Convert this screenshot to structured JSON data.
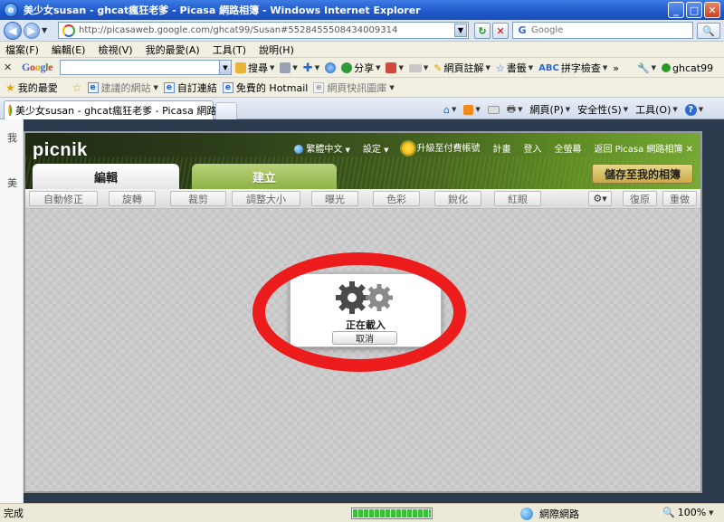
{
  "window": {
    "title": "美少女susan - ghcat瘋狂老爹 - Picasa 網路相簿 - Windows Internet Explorer",
    "min_label": "_",
    "max_label": "□",
    "close_label": "✕"
  },
  "address": {
    "url": "http://picasaweb.google.com/ghcat99/Susan#5528455508434009314",
    "search_placeholder": "Google"
  },
  "menu": [
    "檔案(F)",
    "編輯(E)",
    "檢視(V)",
    "我的最愛(A)",
    "工具(T)",
    "說明(H)"
  ],
  "google_toolbar": {
    "logo": "Google",
    "search_btn": "搜尋",
    "share": "分享",
    "annotate": "網頁註解",
    "bookmarks": "書籤",
    "spellcheck": "拼字檢查",
    "user": "ghcat99",
    "more": "»"
  },
  "favorites": {
    "label": "我的最愛",
    "items": [
      "建議的網站",
      "自訂連結",
      "免費的 Hotmail",
      "網頁快訊圖庫"
    ]
  },
  "tab": {
    "title": "美少女susan - ghcat瘋狂老爹 - Picasa 網路相簿"
  },
  "commandbar": {
    "page": "網頁(P)",
    "safety": "安全性(S)",
    "tools": "工具(O)",
    "help": "?"
  },
  "left_strip": [
    "我",
    "美"
  ],
  "picnik": {
    "logo": "picnik",
    "language": "繁體中文",
    "settings": "設定",
    "upgrade": "升級至付費帳號",
    "plan": "計畫",
    "login": "登入",
    "fullscreen": "全螢幕",
    "back_to_picasa": "返回 Picasa 網路相簿",
    "close": "✕",
    "tab_edit": "編輯",
    "tab_create": "建立",
    "save_button": "儲存至我的相簿",
    "tools": [
      "自動修正",
      "旋轉",
      "裁剪",
      "調整大小",
      "曝光",
      "色彩",
      "銳化",
      "紅眼"
    ],
    "undo": "復原",
    "redo": "重做",
    "loading_text": "正在載入",
    "cancel": "取消"
  },
  "status": {
    "text": "完成",
    "zone": "網際網路",
    "zoom": "100%",
    "progress": 1.0
  }
}
